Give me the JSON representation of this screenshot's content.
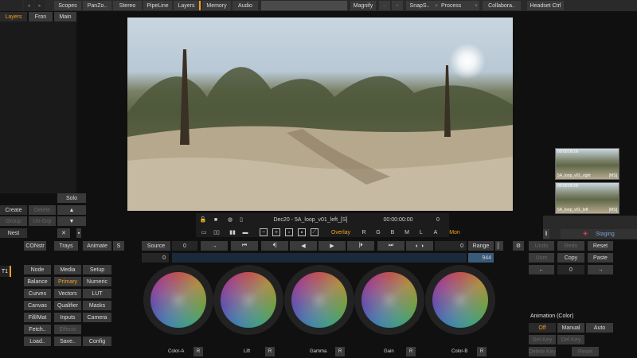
{
  "menu": {
    "scopes": "Scopes",
    "panzoom": "PanZo..",
    "stereo": "Stereo",
    "pipeline": "PipeLine",
    "layers": "Layers",
    "memory": "Memory",
    "audio": "Audio",
    "magnify": "Magnify",
    "snapshot": "SnapS..",
    "process": "Process",
    "collabora": "Collabora..",
    "headset": "Headset Ctrl"
  },
  "left_tabs": {
    "layers": "Layers",
    "from": "Fron",
    "main": "Main"
  },
  "layer_ops": {
    "solo": "Solo",
    "create": "Create",
    "delete": "Delete",
    "group": "Group",
    "ungroup": "Un-Grp",
    "nest": "Nest"
  },
  "video": {
    "filename": "Dec20 - 5A_loop_v01_left_[S]",
    "timecode": "00:00:00:00",
    "frame": "0"
  },
  "viewer_controls": {
    "overlay": "Overlay",
    "r": "R",
    "g": "G",
    "b": "B",
    "m": "M",
    "l": "L",
    "a": "A",
    "mon": "Mon"
  },
  "thumbnails": [
    {
      "tc": "00:00:00:00",
      "name": "5A_loop_v01_right",
      "tag": "[MS]"
    },
    {
      "tc": "00:00:00:00",
      "name": "5A_loop_v01_left",
      "tag": "[MS]"
    }
  ],
  "staging": "Staging",
  "transport": {
    "source": "Source",
    "frame_left": "0",
    "frame_right": "0",
    "range": "Range",
    "range_value": "944",
    "source_value": "0"
  },
  "tabs": {
    "constr": "CONstr",
    "trays": "Trays",
    "animate": "Animate",
    "s": "S"
  },
  "t1": "T1",
  "menus_col1": [
    "Node",
    "Balance",
    "Curves",
    "Canvas",
    "Fill/Mat",
    "Fetch..",
    "Load.."
  ],
  "menus_col2": [
    "Media",
    "Primary",
    "Vectors",
    "Qualifier",
    "Inputs",
    "Effects",
    "Save.."
  ],
  "menus_col3": [
    "Setup",
    "Numeric",
    "LUT",
    "Masks",
    "Camera",
    "",
    "Config"
  ],
  "wheels": [
    {
      "label": "Color-A",
      "btn": "R"
    },
    {
      "label": "Lift",
      "btn": "R"
    },
    {
      "label": "Gamma",
      "btn": "R"
    },
    {
      "label": "Gain",
      "btn": "R"
    },
    {
      "label": "Color-B",
      "btn": "R"
    }
  ],
  "right_panel": {
    "undo": "Undo",
    "redo": "Redo",
    "reset": "Reset",
    "uom": "Uom",
    "copy": "Copy",
    "paste": "Paste",
    "counter": "0"
  },
  "animation": {
    "title": "Animation (Color)",
    "off": "Off",
    "manual": "Manual",
    "auto": "Auto",
    "set_key": "Set Key",
    "del_key": "Del Key",
    "delete_key": "Delete Key",
    "reset": "Reset"
  },
  "colors": {
    "accent": "#f0a020",
    "bg": "#101010",
    "button": "#3a3a3a",
    "staging": "#7aa0d0"
  }
}
